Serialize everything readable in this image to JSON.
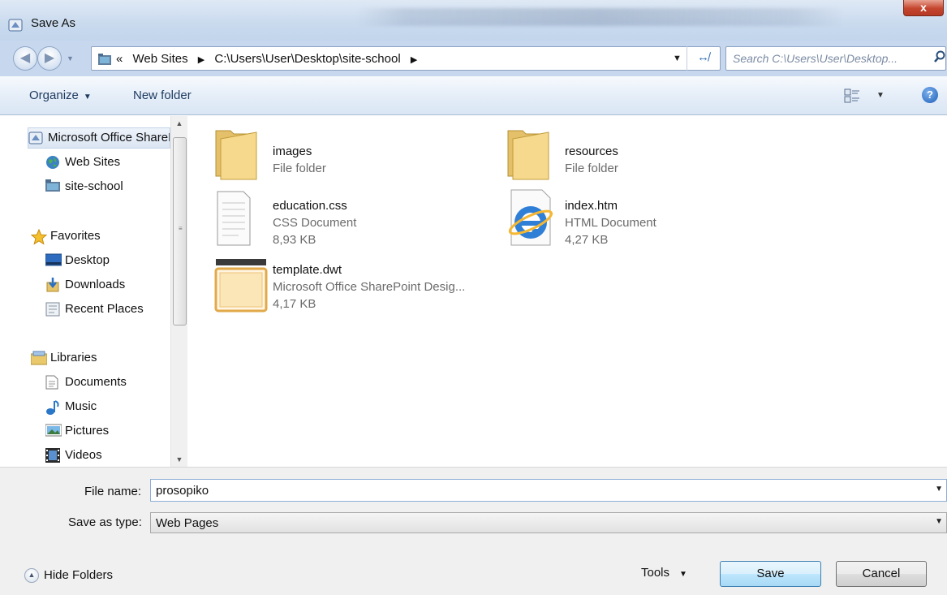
{
  "window": {
    "title": "Save As",
    "close_glyph": "x"
  },
  "address": {
    "crumbs": [
      "«",
      "Web Sites",
      "C:\\Users\\User\\Desktop\\site-school"
    ],
    "search_placeholder": "Search C:\\Users\\User\\Desktop...",
    "refresh_glyph": "↮"
  },
  "toolbar": {
    "organize": "Organize",
    "new_folder": "New folder",
    "help": "?"
  },
  "nav": {
    "items": [
      {
        "label": "Microsoft Office SharePoint Designer Sites",
        "icon": "sharepoint-icon"
      },
      {
        "label": "Web Sites",
        "icon": "globe-icon"
      },
      {
        "label": "site-school",
        "icon": "site-folder-icon"
      },
      {
        "label": "Favorites",
        "icon": "star-icon"
      },
      {
        "label": "Desktop",
        "icon": "desktop-icon"
      },
      {
        "label": "Downloads",
        "icon": "downloads-icon"
      },
      {
        "label": "Recent Places",
        "icon": "recent-places-icon"
      },
      {
        "label": "Libraries",
        "icon": "libraries-icon"
      },
      {
        "label": "Documents",
        "icon": "documents-icon"
      },
      {
        "label": "Music",
        "icon": "music-icon"
      },
      {
        "label": "Pictures",
        "icon": "pictures-icon"
      },
      {
        "label": "Videos",
        "icon": "videos-icon"
      }
    ]
  },
  "files": [
    {
      "name": "images",
      "type": "File folder",
      "size": "",
      "icon": "folder-icon"
    },
    {
      "name": "resources",
      "type": "File folder",
      "size": "",
      "icon": "folder-icon"
    },
    {
      "name": "education.css",
      "type": "CSS Document",
      "size": "8,93 KB",
      "icon": "text-document-icon"
    },
    {
      "name": "index.htm",
      "type": "HTML Document",
      "size": "4,27 KB",
      "icon": "internet-explorer-icon"
    },
    {
      "name": "template.dwt",
      "type": "Microsoft Office SharePoint Desig...",
      "size": "4,17 KB",
      "icon": "template-icon"
    }
  ],
  "form": {
    "file_name_label": "File name:",
    "file_name_value": "prosopiko",
    "save_type_label": "Save as type:",
    "save_type_value": "Web Pages"
  },
  "footer": {
    "hide_folders": "Hide Folders",
    "tools": "Tools",
    "save": "Save",
    "cancel": "Cancel"
  },
  "colors": {
    "accent": "#2e6db4",
    "titlebar": "#c9daee",
    "close": "#c5452e"
  }
}
